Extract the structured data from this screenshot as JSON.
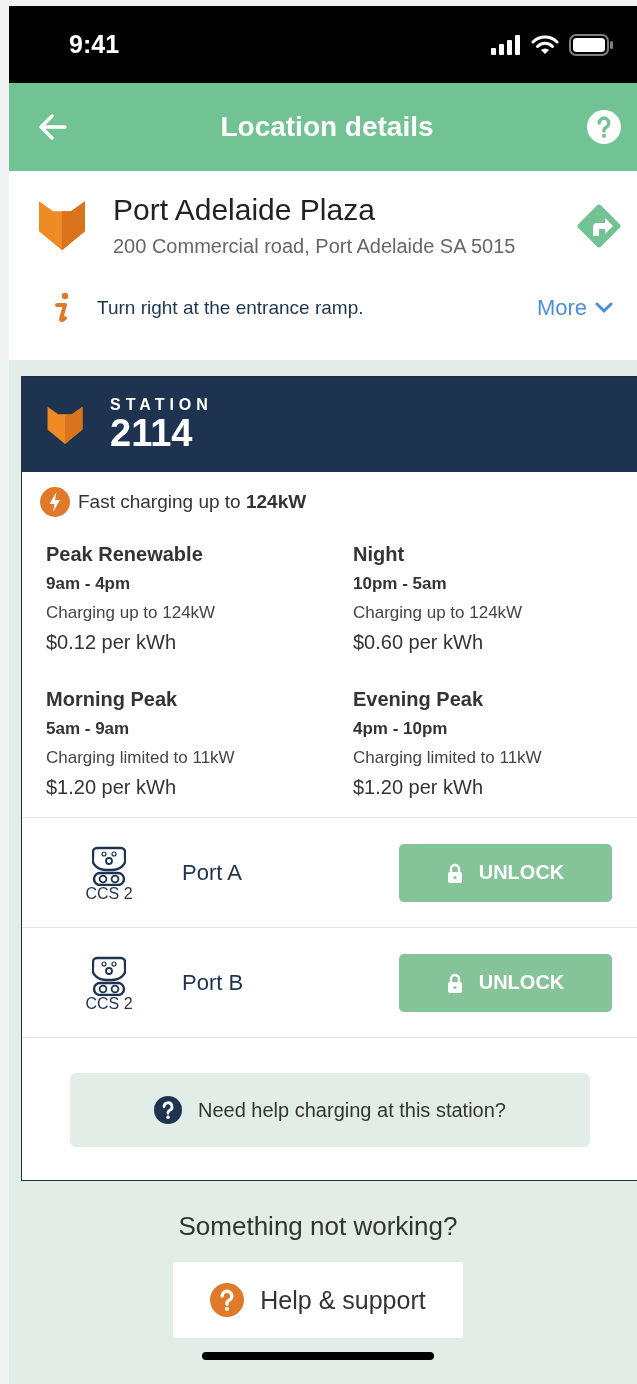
{
  "status_bar": {
    "time": "9:41"
  },
  "header": {
    "title": "Location details"
  },
  "location": {
    "name": "Port Adelaide Plaza",
    "address": "200 Commercial road, Port Adelaide SA 5015",
    "note": "Turn right at the entrance ramp.",
    "more_link": "More"
  },
  "station": {
    "label": "STATION",
    "number": "2114",
    "speed": "Fast charging up to **124kW**",
    "rates": [
      {
        "name": "Peak Renewable",
        "hours": "9am - 4pm",
        "limit": "Charging up to 124kW",
        "price": "$0.12 per kWh"
      },
      {
        "name": "Night",
        "hours": "10pm - 5am",
        "limit": "Charging up to 124kW",
        "price": "$0.60 per kWh"
      },
      {
        "name": "Morning Peak",
        "hours": "5am - 9am",
        "limit": "Charging limited to 11kW",
        "price": "$1.20 per kWh"
      },
      {
        "name": "Evening Peak",
        "hours": "4pm - 10pm",
        "limit": "Charging limited to 11kW",
        "price": "$1.20 per kWh"
      }
    ],
    "ports": [
      {
        "connector": "CCS 2",
        "name": "Port A",
        "button": "UNLOCK"
      },
      {
        "connector": "CCS 2",
        "name": "Port B",
        "button": "UNLOCK"
      }
    ],
    "help_link": "Need help charging at this station?"
  },
  "footer": {
    "prompt": "Something not working?",
    "button": "Help & support"
  }
}
